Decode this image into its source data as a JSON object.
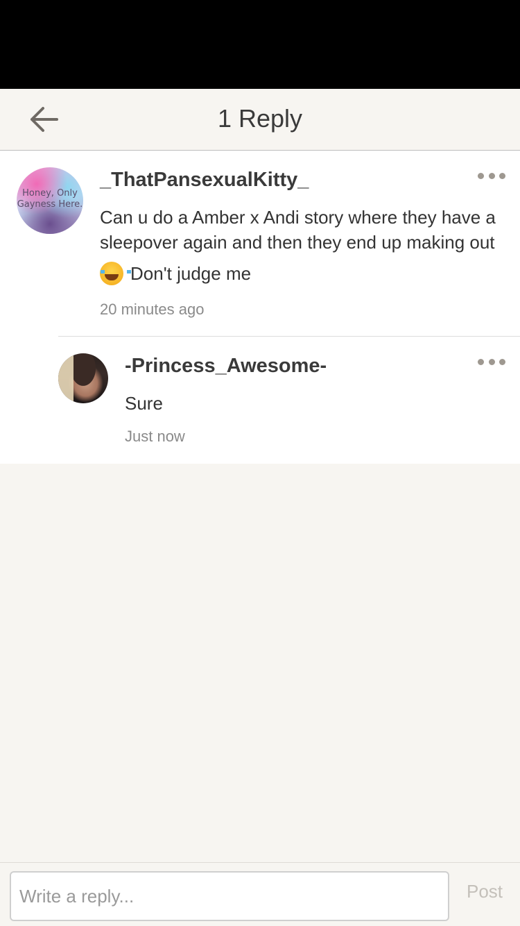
{
  "header": {
    "title": "1 Reply",
    "back_icon": "arrow-left-icon"
  },
  "comments": [
    {
      "username": "_ThatPansexualKitty_",
      "avatar_text": "Honey, Only\nGayness Here.",
      "text": "Can u do a Amber x Andi story where they have a sleepover again and then they end up making out",
      "emoji": "tears-of-joy-icon",
      "text_after_emoji": "Don't judge me",
      "timestamp": "20 minutes ago",
      "more_icon": "ellipsis-icon"
    },
    {
      "username": "-Princess_Awesome-",
      "text": "Sure",
      "timestamp": "Just now",
      "more_icon": "ellipsis-icon"
    }
  ],
  "footer": {
    "reply_placeholder": "Write a reply...",
    "post_label": "Post"
  },
  "colors": {
    "background": "#f7f5f1",
    "card": "#ffffff",
    "text": "#3a3a3a",
    "muted": "#8a8a8a",
    "post_disabled": "#c4c0ba"
  }
}
